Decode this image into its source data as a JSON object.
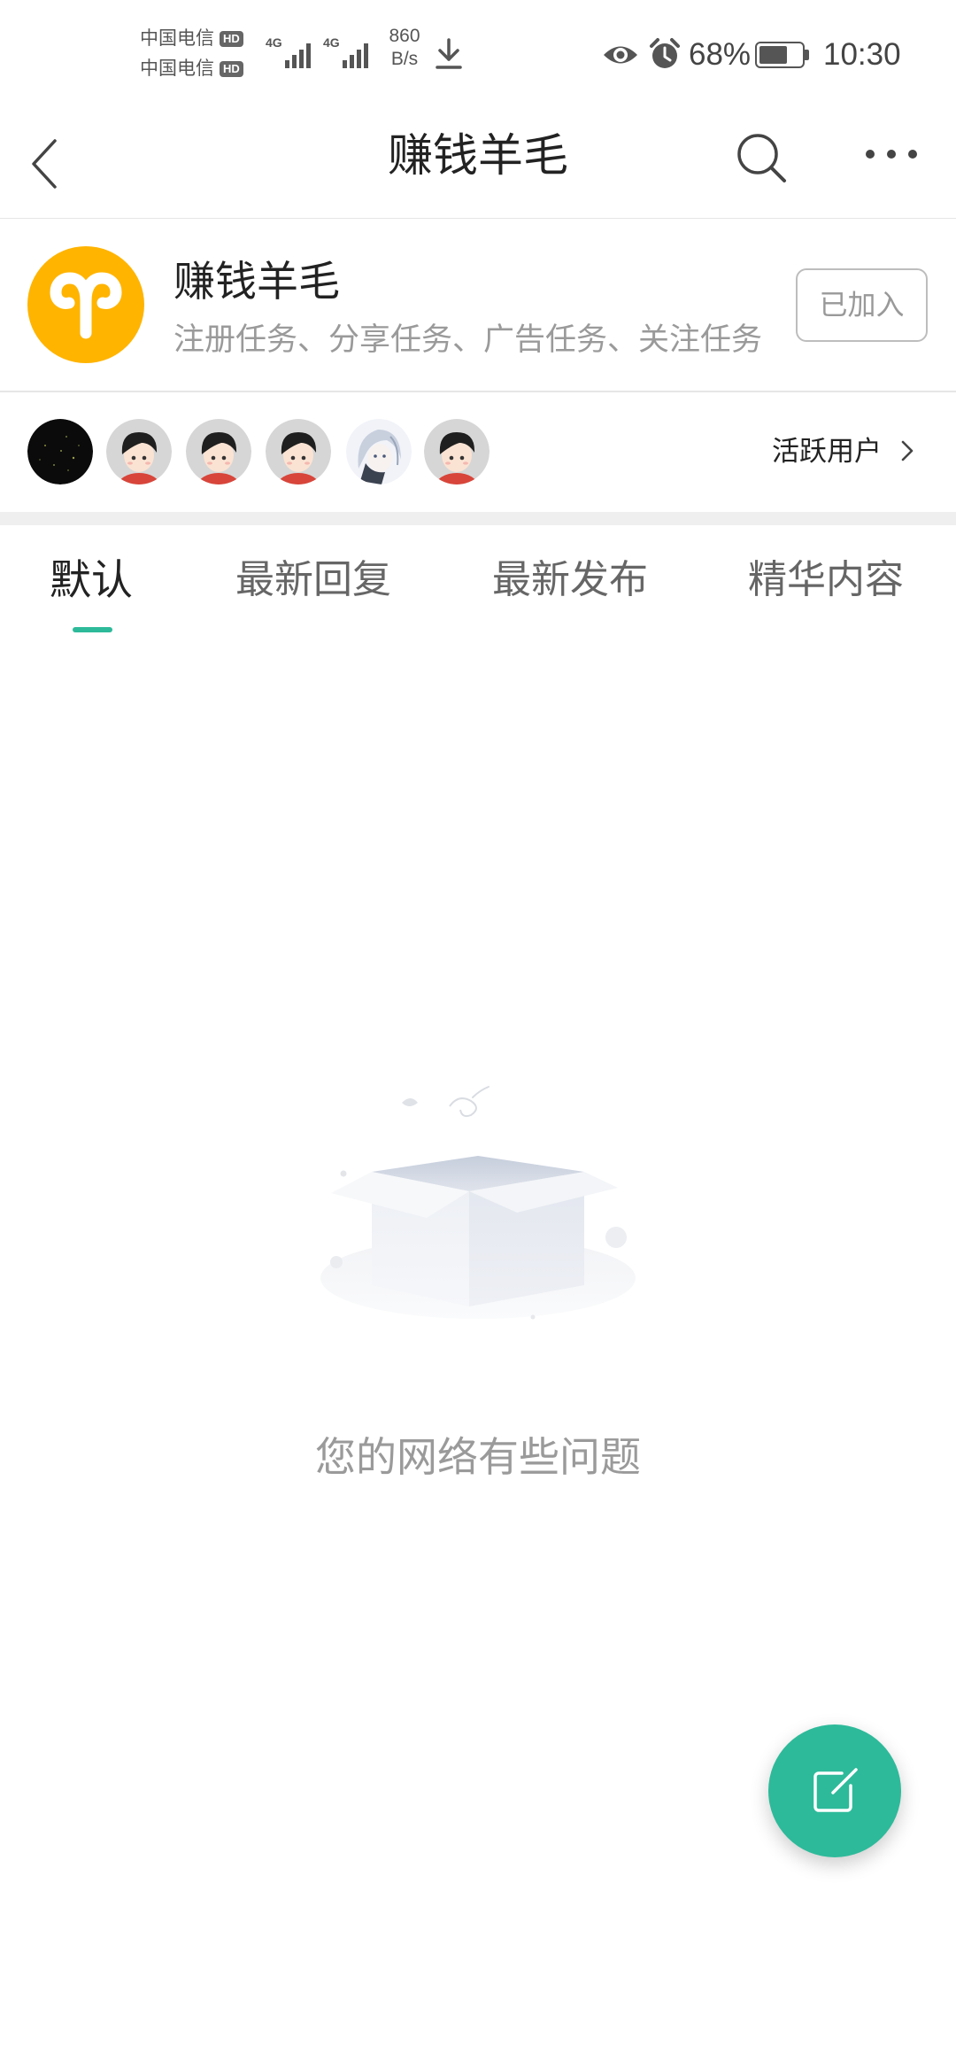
{
  "status_bar": {
    "carriers": [
      {
        "name": "中国电信",
        "badge": "HD"
      },
      {
        "name": "中国电信",
        "badge": "HD"
      }
    ],
    "signals": [
      {
        "network": "4G",
        "icon": "signal-icon"
      },
      {
        "network": "4G",
        "icon": "signal-icon"
      }
    ],
    "net_speed": {
      "value": "860",
      "unit": "B/s"
    },
    "icons": {
      "download": "download-icon",
      "eye": "eye-icon",
      "alarm": "alarm-icon",
      "battery": "battery-icon"
    },
    "battery_text": "68%",
    "battery_level": 68,
    "time": "10:30"
  },
  "header": {
    "title": "赚钱羊毛",
    "back_icon": "back-arrow-icon",
    "search_icon": "search-icon",
    "more_icon": "more-icon"
  },
  "group": {
    "logo_icon": "aries-ram-icon",
    "name": "赚钱羊毛",
    "description": "注册任务、分享任务、广告任务、关注任务",
    "join_label": "已加入"
  },
  "active_users": {
    "label": "活跃用户",
    "chevron_icon": "chevron-right-icon",
    "avatars": [
      {
        "icon": "avatar-dark"
      },
      {
        "icon": "avatar-cartoon-boy"
      },
      {
        "icon": "avatar-cartoon-boy"
      },
      {
        "icon": "avatar-cartoon-boy"
      },
      {
        "icon": "avatar-anime-girl"
      },
      {
        "icon": "avatar-cartoon-boy"
      }
    ]
  },
  "tabs": [
    {
      "label": "默认",
      "active": true
    },
    {
      "label": "最新回复",
      "active": false
    },
    {
      "label": "最新发布",
      "active": false
    },
    {
      "label": "精华内容",
      "active": false
    }
  ],
  "empty_state": {
    "illustration": "empty-box-illustration",
    "message": "您的网络有些问题"
  },
  "fab": {
    "icon": "edit-icon"
  },
  "colors": {
    "accent": "#2DBA9A",
    "group_logo": "#FFB400",
    "text_primary": "#222222",
    "text_secondary": "#999999"
  }
}
